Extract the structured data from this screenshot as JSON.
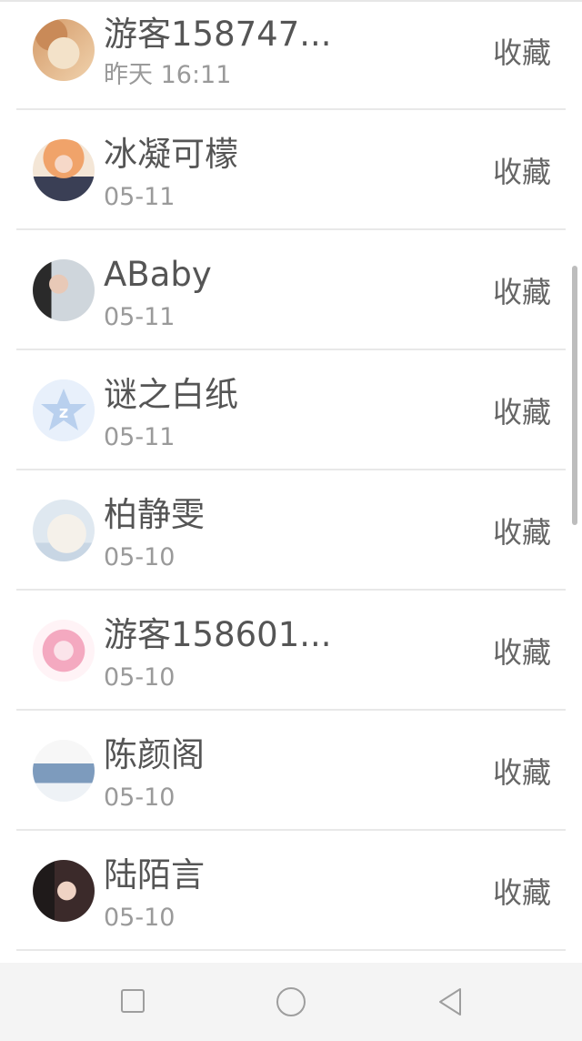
{
  "list": {
    "items": [
      {
        "name": "游客158747...",
        "time": "昨天 16:11",
        "action": "收藏"
      },
      {
        "name": "冰凝可檬",
        "time": "05-11",
        "action": "收藏"
      },
      {
        "name": "ABaby",
        "time": "05-11",
        "action": "收藏"
      },
      {
        "name": "谜之白纸",
        "time": "05-11",
        "action": "收藏"
      },
      {
        "name": "柏静雯",
        "time": "05-10",
        "action": "收藏"
      },
      {
        "name": "游客158601...",
        "time": "05-10",
        "action": "收藏"
      },
      {
        "name": "陈颜阁",
        "time": "05-10",
        "action": "收藏"
      },
      {
        "name": "陆陌言",
        "time": "05-10",
        "action": "收藏"
      }
    ]
  },
  "navbar": {
    "icons": [
      "square-recent-apps-icon",
      "circle-home-icon",
      "triangle-back-icon"
    ]
  },
  "colors": {
    "name_text": "#555555",
    "time_text": "#9a9a9a",
    "action_text": "#666666",
    "divider": "#e8e8e8",
    "navbar_bg": "#f4f4f4",
    "nav_icon": "#9e9e9e"
  }
}
